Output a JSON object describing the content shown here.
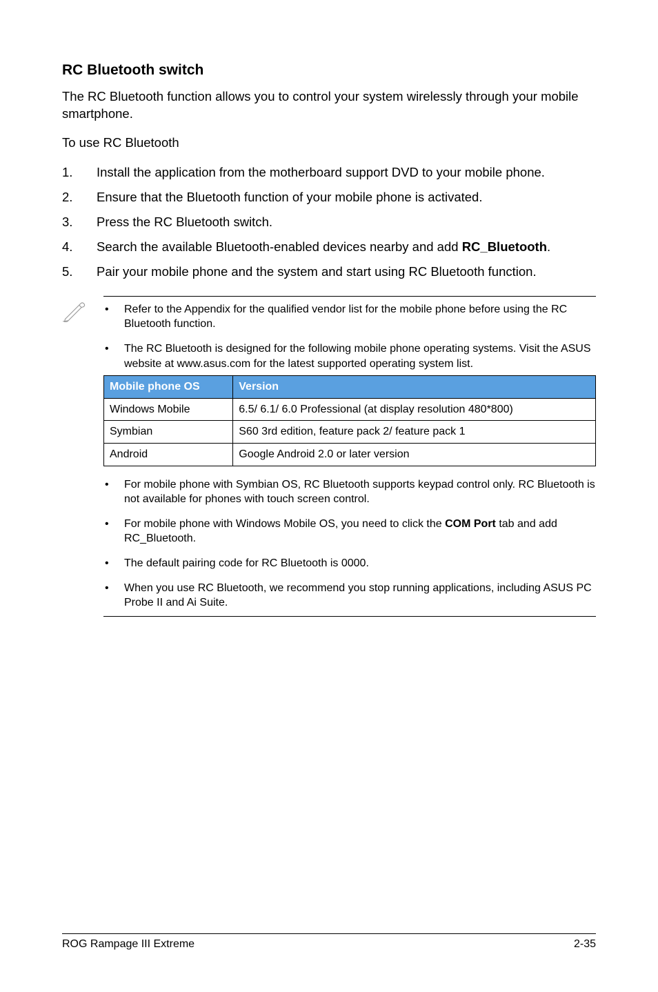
{
  "heading": "RC Bluetooth switch",
  "intro": "The RC Bluetooth function allows you to control your system wirelessly through your mobile smartphone.",
  "subline": "To use RC Bluetooth",
  "steps": [
    "Install the application from the motherboard support DVD to your mobile phone.",
    "Ensure that the Bluetooth function of your mobile phone is activated.",
    "Press the RC Bluetooth switch.",
    {
      "pre": "Search the available Bluetooth-enabled devices nearby and add ",
      "bold": "RC_Bluetooth",
      "post": "."
    },
    "Pair your mobile phone and the system and start using RC Bluetooth function."
  ],
  "notes_top": [
    "Refer to the Appendix for the qualified vendor list for the mobile phone before using the RC Bluetooth function.",
    "The RC Bluetooth is designed for the following mobile phone operating systems. Visit the ASUS website at www.asus.com for the latest supported operating system list."
  ],
  "table": {
    "headers": [
      "Mobile phone OS",
      "Version"
    ],
    "rows": [
      [
        "Windows Mobile",
        "6.5/ 6.1/ 6.0 Professional (at display resolution 480*800)"
      ],
      [
        "Symbian",
        "S60 3rd edition, feature pack 2/ feature pack 1"
      ],
      [
        "Android",
        "Google Android 2.0 or later version"
      ]
    ]
  },
  "notes_bottom": [
    "For mobile phone with Symbian OS, RC Bluetooth supports keypad control only. RC Bluetooth is not available for phones with touch screen control.",
    {
      "pre": "For mobile phone with Windows Mobile OS, you need to click the ",
      "bold": "COM Port",
      "post": " tab and add RC_Bluetooth."
    },
    "The default pairing code for RC Bluetooth is 0000.",
    "When you use RC Bluetooth, we recommend you stop running applications, including ASUS PC Probe II and Ai Suite."
  ],
  "footer": {
    "left": "ROG Rampage III Extreme",
    "right": "2-35"
  }
}
